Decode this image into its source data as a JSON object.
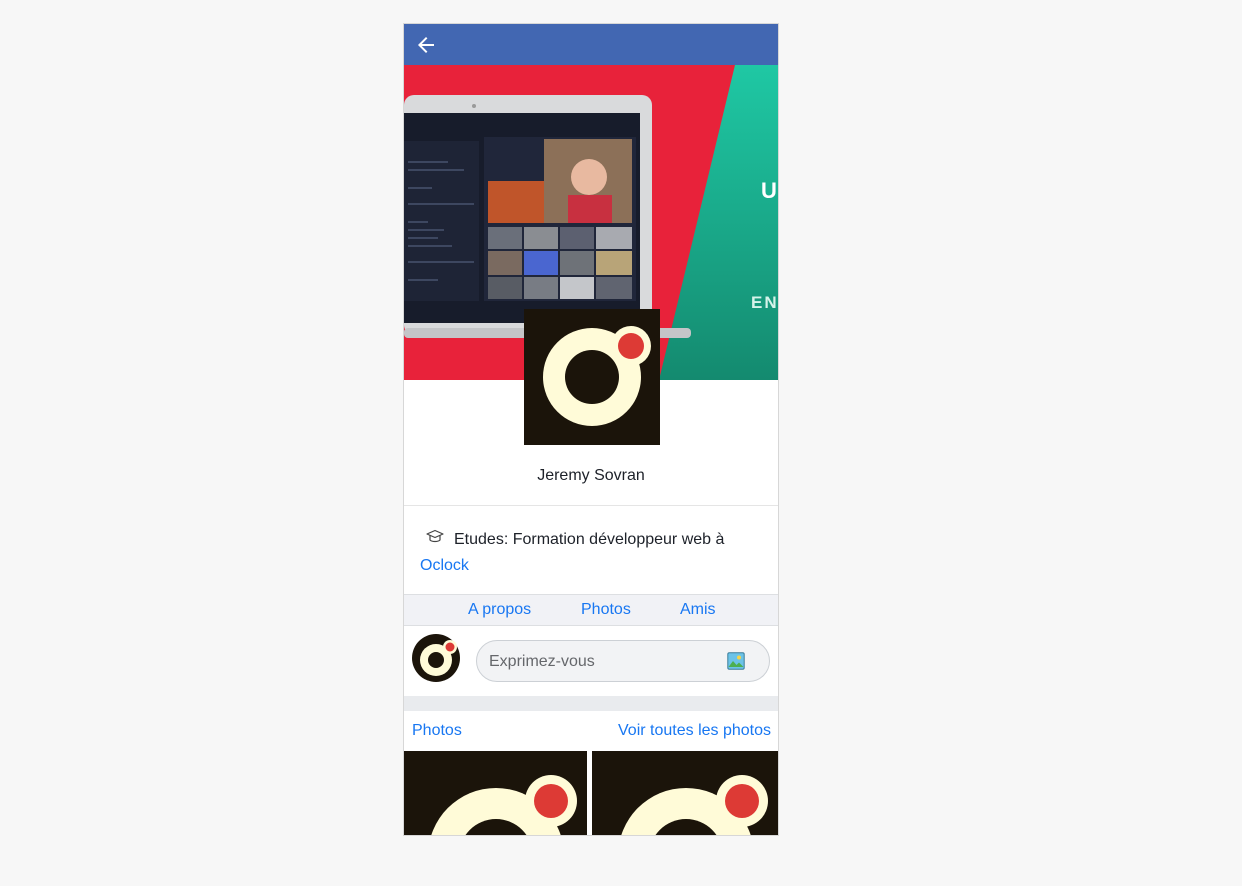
{
  "header": {
    "back_icon": "arrow-left-icon",
    "bar_color": "#4267b2"
  },
  "cover": {
    "letters": [
      "U",
      "EN"
    ],
    "colors": {
      "red": "#e8223a",
      "teal": "#1fc4a2"
    }
  },
  "profile": {
    "name": "Jeremy Sovran",
    "avatar_icon": "oclock-logo"
  },
  "intro": {
    "studies_icon": "graduation-cap-icon",
    "studies_text": "Etudes: Formation développeur web à",
    "school_link": "Oclock"
  },
  "tabs": [
    {
      "label": "A propos"
    },
    {
      "label": "Photos"
    },
    {
      "label": "Amis"
    }
  ],
  "composer": {
    "placeholder": "Exprimez-vous",
    "photo_icon": "photo-icon"
  },
  "photos": {
    "title": "Photos",
    "see_all": "Voir toutes les photos"
  },
  "accent_color": "#1877f2"
}
